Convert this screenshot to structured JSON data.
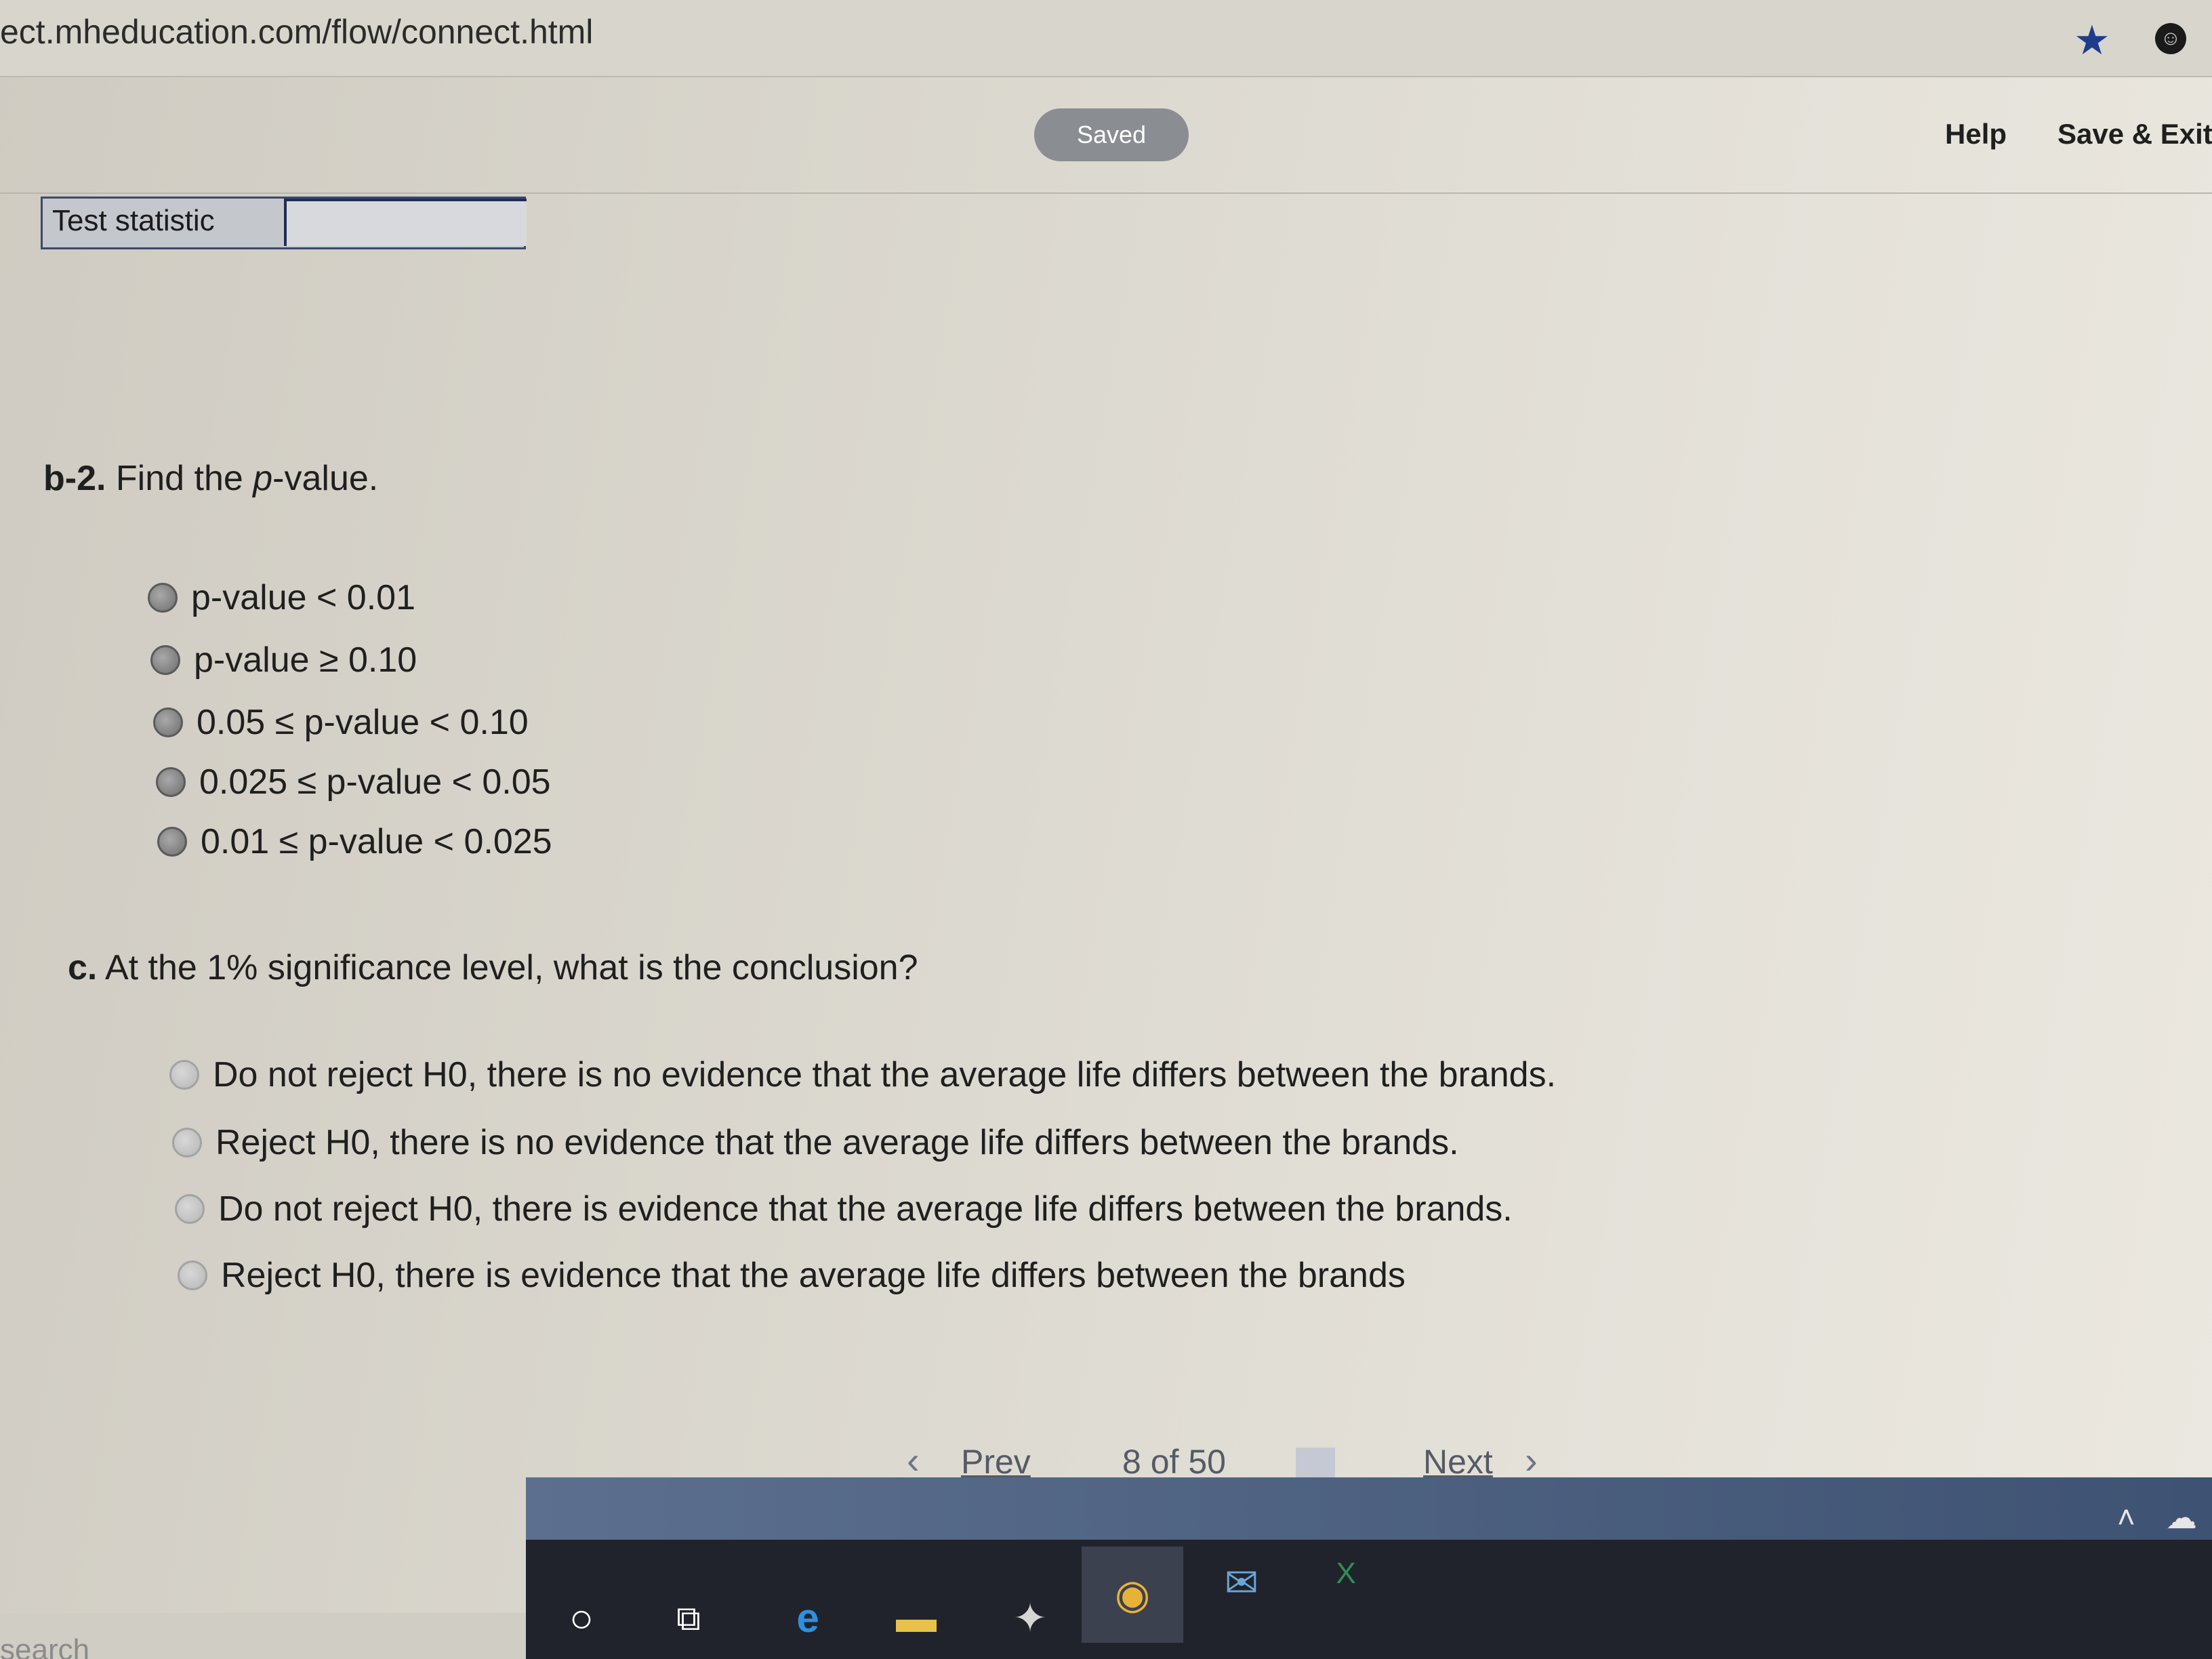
{
  "browser": {
    "url": "ect.mheducation.com/flow/connect.html",
    "bookmark_icon": "star-icon",
    "profile_icon": "profile-icon"
  },
  "header": {
    "saved_label": "Saved",
    "help_label": "Help",
    "save_exit_label": "Save & Exit"
  },
  "test_statistic": {
    "label": "Test statistic",
    "value": ""
  },
  "question_b2": {
    "number": "b-2.",
    "text_before": "Find the ",
    "italic": "p",
    "text_after": "-value.",
    "options": [
      "p-value < 0.01",
      "p-value ≥ 0.10",
      "0.05 ≤ p-value < 0.10",
      "0.025 ≤ p-value < 0.05",
      "0.01 ≤ p-value < 0.025"
    ]
  },
  "question_c": {
    "number": "c.",
    "text": "At the 1% significance level, what is the conclusion?",
    "options": [
      "Do not reject H0, there is no evidence that the average life differs between the brands.",
      "Reject H0, there is no evidence that the average life differs between the brands.",
      "Do not reject H0, there is evidence that the average life differs between the brands.",
      "Reject H0, there is evidence that the average life differs between the brands"
    ]
  },
  "navigation": {
    "prev_label": "Prev",
    "current": "8",
    "of_label": "of",
    "total": "50",
    "next_label": "Next",
    "grid_icon": "grid-icon"
  },
  "taskbar": {
    "search_text": "search",
    "icons": [
      "cortana-icon",
      "task-view-icon",
      "edge-icon",
      "file-explorer-icon",
      "app-icon",
      "chrome-icon",
      "mail-icon",
      "excel-icon"
    ],
    "tray_icons": [
      "chevron-up-icon",
      "onedrive-icon"
    ]
  }
}
